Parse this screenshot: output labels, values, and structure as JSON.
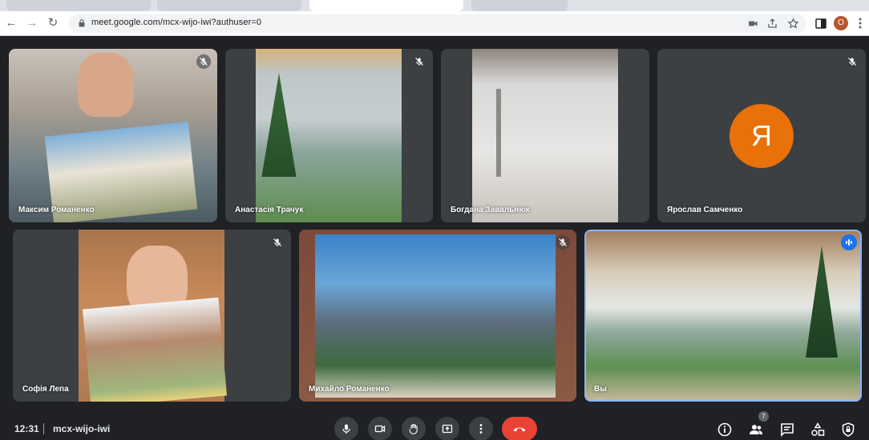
{
  "browser": {
    "url": "meet.google.com/mcx-wijo-iwi?authuser=0",
    "profile_initial": "O"
  },
  "participants": [
    {
      "name": "Максим Романенко",
      "muted": true
    },
    {
      "name": "Анастасія Трачук",
      "muted": true
    },
    {
      "name": "Богдана Завальнюк",
      "muted": true
    },
    {
      "name": "Ярослав Самченко",
      "muted": true,
      "avatar_letter": "Я",
      "avatar_color": "#e8710a"
    },
    {
      "name": "Софія Лепа",
      "muted": true
    },
    {
      "name": "Михайло Романенко",
      "muted": true
    },
    {
      "name": "Вы",
      "speaking": true
    }
  ],
  "bottombar": {
    "time": "12:31",
    "meeting_code": "mcx-wijo-iwi",
    "people_count": "7"
  },
  "colors": {
    "background": "#202124",
    "tile": "#3c4043",
    "end_call": "#ea4335",
    "speaking_border": "#8ab4f8",
    "speaking_indicator": "#1a73e8"
  }
}
